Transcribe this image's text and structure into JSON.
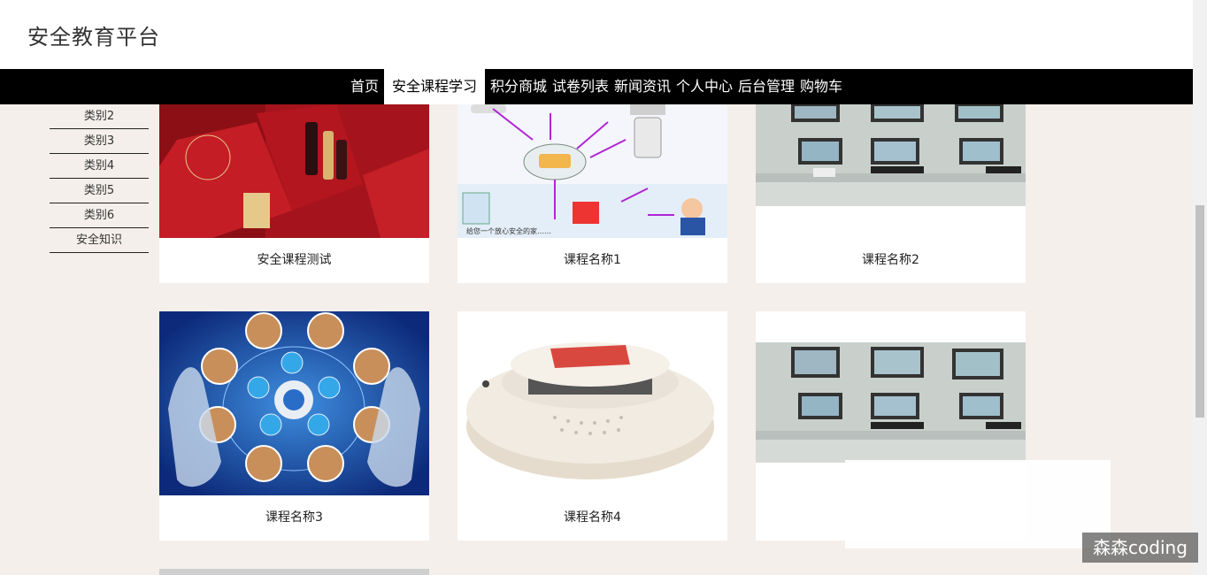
{
  "header": {
    "title": "安全教育平台"
  },
  "nav": {
    "items": [
      {
        "label": "首页",
        "active": false
      },
      {
        "label": "安全课程学习",
        "active": true
      },
      {
        "label": "积分商城",
        "active": false
      },
      {
        "label": "试卷列表",
        "active": false
      },
      {
        "label": "新闻资讯",
        "active": false
      },
      {
        "label": "个人中心",
        "active": false
      },
      {
        "label": "后台管理",
        "active": false
      },
      {
        "label": "购物车",
        "active": false
      }
    ]
  },
  "sidebar": {
    "items": [
      "类别2",
      "类别3",
      "类别4",
      "类别5",
      "类别6",
      "安全知识"
    ]
  },
  "courses": [
    {
      "title": "安全课程测试",
      "image": "red-gift-box-photo"
    },
    {
      "title": "课程名称1",
      "image": "alarm-system-diagram"
    },
    {
      "title": "课程名称2",
      "image": "monitor-control-room-photo"
    },
    {
      "title": "课程名称3",
      "image": "hands-globe-network-photo"
    },
    {
      "title": "课程名称4",
      "image": "smoke-detector-photo"
    },
    {
      "title": "",
      "image": "monitor-control-room-photo"
    }
  ],
  "watermark": "森森coding"
}
